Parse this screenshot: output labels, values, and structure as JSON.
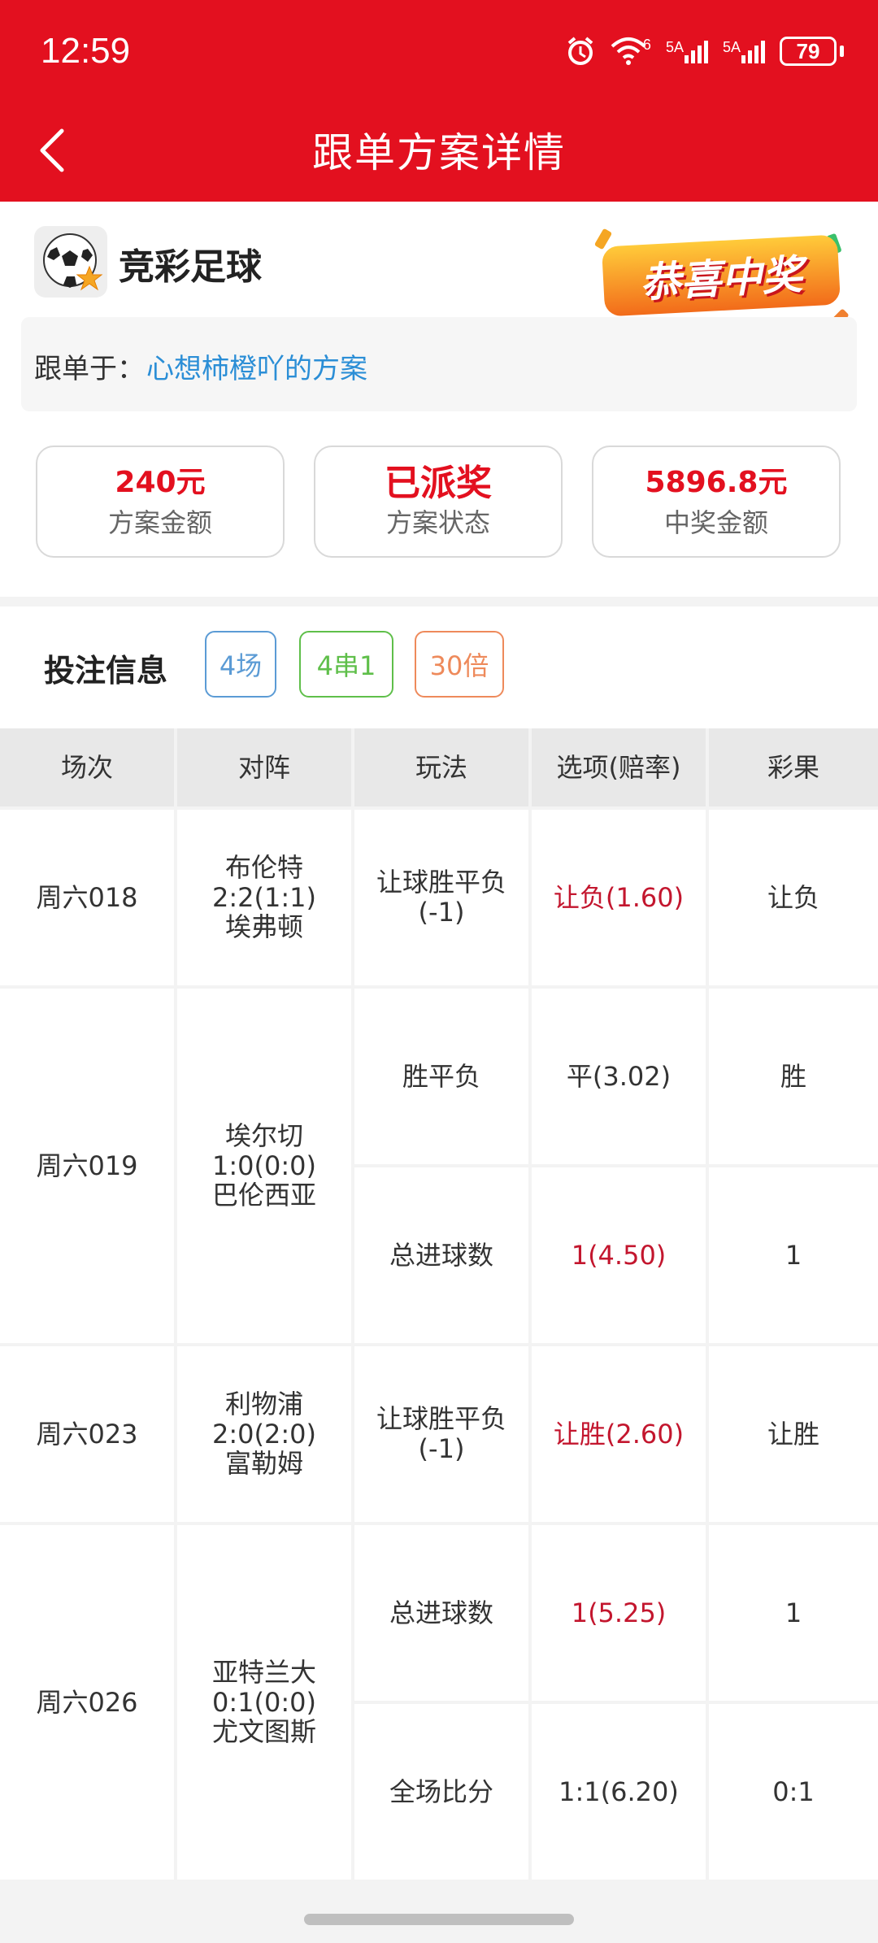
{
  "status_bar": {
    "time": "12:59",
    "net1": "6",
    "sig1": "5A",
    "sig2": "5A",
    "battery": "79"
  },
  "nav": {
    "title": "跟单方案详情",
    "back_icon": "chevron-left-icon"
  },
  "brand": {
    "name": "竞彩足球",
    "logo_icon": "soccer-ball-star-icon",
    "badge": "恭喜中奖"
  },
  "follow": {
    "label": "跟单于：",
    "link": "心想柿橙吖的方案"
  },
  "stats": [
    {
      "value": "240元",
      "label": "方案金额"
    },
    {
      "value": "已派奖",
      "label": "方案状态"
    },
    {
      "value": "5896.8元",
      "label": "中奖金额"
    }
  ],
  "bet_info": {
    "title": "投注信息",
    "tags": [
      {
        "text": "4场",
        "color": "#5b9bd5"
      },
      {
        "text": "4串1",
        "color": "#5fbf4a"
      },
      {
        "text": "30倍",
        "color": "#ee8a5b"
      }
    ]
  },
  "table": {
    "headers": [
      "场次",
      "对阵",
      "玩法",
      "选项(赔率)",
      "彩果"
    ],
    "matches": [
      {
        "session": "周六018",
        "home": "布伦特",
        "score": "2:2(1:1)",
        "away": "埃弗顿",
        "bets": [
          {
            "play": "让球胜平负",
            "play2": "(-1)",
            "option": "让负(1.60)",
            "result": "让负",
            "hit": true
          }
        ]
      },
      {
        "session": "周六019",
        "home": "埃尔切",
        "score": "1:0(0:0)",
        "away": "巴伦西亚",
        "bets": [
          {
            "play": "胜平负",
            "play2": "",
            "option": "平(3.02)",
            "result": "胜",
            "hit": false
          },
          {
            "play": "总进球数",
            "play2": "",
            "option": "1(4.50)",
            "result": "1",
            "hit": true
          }
        ]
      },
      {
        "session": "周六023",
        "home": "利物浦",
        "score": "2:0(2:0)",
        "away": "富勒姆",
        "bets": [
          {
            "play": "让球胜平负",
            "play2": "(-1)",
            "option": "让胜(2.60)",
            "result": "让胜",
            "hit": true
          }
        ]
      },
      {
        "session": "周六026",
        "home": "亚特兰大",
        "score": "0:1(0:0)",
        "away": "尤文图斯",
        "bets": [
          {
            "play": "总进球数",
            "play2": "",
            "option": "1(5.25)",
            "result": "1",
            "hit": true
          },
          {
            "play": "全场比分",
            "play2": "",
            "option": "1:1(6.20)",
            "result": "0:1",
            "hit": false
          }
        ]
      }
    ]
  },
  "colors": {
    "header_red": "#e3101f",
    "link_blue": "#2b8ed6",
    "hit_red": "#c3162e"
  }
}
